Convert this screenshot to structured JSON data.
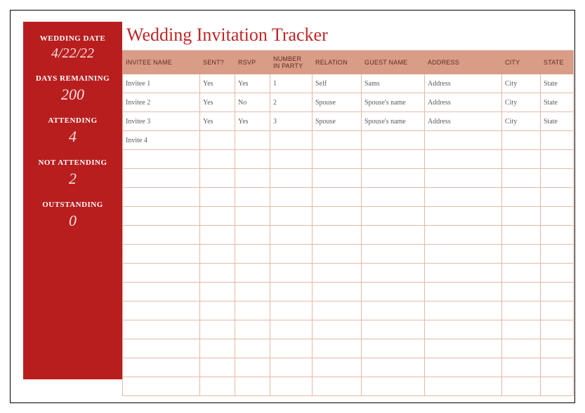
{
  "title": "Wedding Invitation Tracker",
  "sidebar": {
    "weddingDateLabel": "WEDDING DATE",
    "weddingDateValue": "4/22/22",
    "daysRemainingLabel": "DAYS REMAINING",
    "daysRemainingValue": "200",
    "attendingLabel": "ATTENDING",
    "attendingValue": "4",
    "notAttendingLabel": "NOT ATTENDING",
    "notAttendingValue": "2",
    "outstandingLabel": "OUTSTANDING",
    "outstandingValue": "0"
  },
  "columns": [
    "INVITEE NAME",
    "SENT?",
    "RSVP",
    "NUMBER IN PARTY",
    "RELATION",
    "GUEST NAME",
    "ADDRESS",
    "CITY",
    "STATE"
  ],
  "rows": [
    {
      "invitee": "Invitee 1",
      "sent": "Yes",
      "rsvp": "Yes",
      "num": "1",
      "relation": "Self",
      "guest": "Sams",
      "address": "Address",
      "city": "City",
      "state": "State"
    },
    {
      "invitee": "Invitee 2",
      "sent": "Yes",
      "rsvp": "No",
      "num": "2",
      "relation": "Spouse",
      "guest": "Spouse's name",
      "address": "Address",
      "city": "City",
      "state": "State"
    },
    {
      "invitee": "Invitee 3",
      "sent": "Yes",
      "rsvp": "Yes",
      "num": "3",
      "relation": "Spouse",
      "guest": "Spouse's name",
      "address": "Address",
      "city": "City",
      "state": "State"
    },
    {
      "invitee": "Invite 4",
      "sent": "",
      "rsvp": "",
      "num": "",
      "relation": "",
      "guest": "",
      "address": "",
      "city": "",
      "state": ""
    },
    {
      "invitee": "",
      "sent": "",
      "rsvp": "",
      "num": "",
      "relation": "",
      "guest": "",
      "address": "",
      "city": "",
      "state": ""
    },
    {
      "invitee": "",
      "sent": "",
      "rsvp": "",
      "num": "",
      "relation": "",
      "guest": "",
      "address": "",
      "city": "",
      "state": ""
    },
    {
      "invitee": "",
      "sent": "",
      "rsvp": "",
      "num": "",
      "relation": "",
      "guest": "",
      "address": "",
      "city": "",
      "state": ""
    },
    {
      "invitee": "",
      "sent": "",
      "rsvp": "",
      "num": "",
      "relation": "",
      "guest": "",
      "address": "",
      "city": "",
      "state": ""
    },
    {
      "invitee": "",
      "sent": "",
      "rsvp": "",
      "num": "",
      "relation": "",
      "guest": "",
      "address": "",
      "city": "",
      "state": ""
    },
    {
      "invitee": "",
      "sent": "",
      "rsvp": "",
      "num": "",
      "relation": "",
      "guest": "",
      "address": "",
      "city": "",
      "state": ""
    },
    {
      "invitee": "",
      "sent": "",
      "rsvp": "",
      "num": "",
      "relation": "",
      "guest": "",
      "address": "",
      "city": "",
      "state": ""
    },
    {
      "invitee": "",
      "sent": "",
      "rsvp": "",
      "num": "",
      "relation": "",
      "guest": "",
      "address": "",
      "city": "",
      "state": ""
    },
    {
      "invitee": "",
      "sent": "",
      "rsvp": "",
      "num": "",
      "relation": "",
      "guest": "",
      "address": "",
      "city": "",
      "state": ""
    },
    {
      "invitee": "",
      "sent": "",
      "rsvp": "",
      "num": "",
      "relation": "",
      "guest": "",
      "address": "",
      "city": "",
      "state": ""
    },
    {
      "invitee": "",
      "sent": "",
      "rsvp": "",
      "num": "",
      "relation": "",
      "guest": "",
      "address": "",
      "city": "",
      "state": ""
    },
    {
      "invitee": "",
      "sent": "",
      "rsvp": "",
      "num": "",
      "relation": "",
      "guest": "",
      "address": "",
      "city": "",
      "state": ""
    },
    {
      "invitee": "",
      "sent": "",
      "rsvp": "",
      "num": "",
      "relation": "",
      "guest": "",
      "address": "",
      "city": "",
      "state": ""
    }
  ]
}
